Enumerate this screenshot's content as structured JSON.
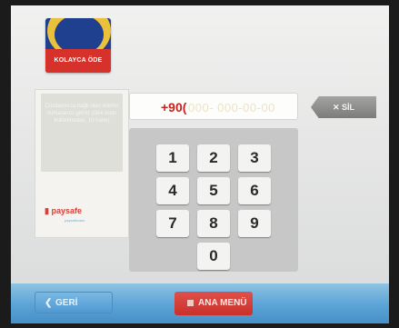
{
  "brand": {
    "logo_text": "KOLAYCA ÖDE"
  },
  "info_panel": {
    "instruction": "Cüzdanınıza bağlı olan telefon numaranızı giriniz (ülke kodu kullanmadan, 10 hane)",
    "provider_logo": "paysafe",
    "provider_tagline": "paysafecash"
  },
  "phone_input": {
    "prefix": "+90(",
    "placeholder": "000- 000-00-00"
  },
  "clear_button": {
    "label": "✕ SİL"
  },
  "keypad": {
    "keys": [
      "1",
      "2",
      "3",
      "4",
      "5",
      "6",
      "7",
      "8",
      "9",
      "0"
    ]
  },
  "footer": {
    "back_label": "GERİ",
    "menu_label": "ANA MENÜ"
  },
  "colors": {
    "brand_blue": "#1f3f8f",
    "brand_red": "#d6312b",
    "accent_yellow": "#e9c13b",
    "footer_blue": "#5aa3d6"
  }
}
